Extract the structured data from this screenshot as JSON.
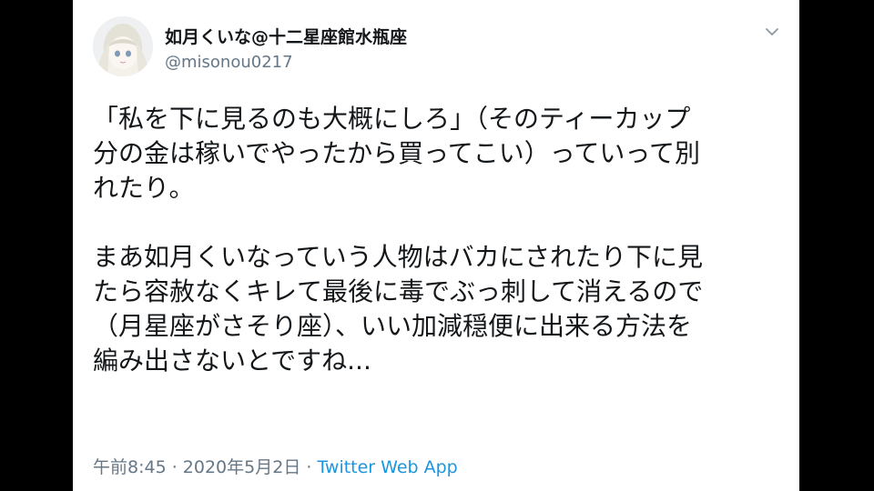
{
  "tweet": {
    "author": {
      "display_name": "如月くいな@十二星座館水瓶座",
      "handle": "@misonou0217"
    },
    "text_paragraphs": [
      [
        "「私を下に見るのも大概にしろ」（そのティーカップ",
        "分の金は稼いでやったから買ってこい）っていって別",
        "れたり。"
      ],
      [
        "まあ如月くいなっていう人物はバカにされたり下に見",
        "たら容赦なくキレて最後に毒でぶっ刺して消えるので",
        "（月星座がさそり座）、いい加減穏便に出来る方法を",
        "編み出さないとですね..."
      ]
    ],
    "meta": {
      "timestamp": "午前8:45 · 2020年5月2日 · ",
      "source": "Twitter Web App"
    }
  },
  "icons": {
    "menu_caret": "chevron-down-icon",
    "avatar": "avatar"
  },
  "colors": {
    "background": "#000000",
    "card": "#ffffff",
    "text": "#14171a",
    "secondary_text": "#657786",
    "link": "#1b95e0"
  }
}
